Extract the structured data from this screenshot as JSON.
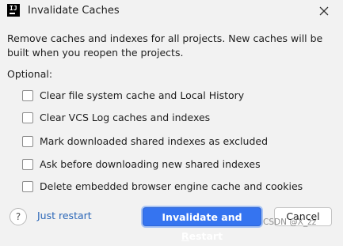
{
  "window": {
    "title": "Invalidate Caches",
    "app_icon_text": "IJ"
  },
  "description": "Remove caches and indexes for all projects. New caches will be built when you reopen the projects.",
  "optional_label": "Optional:",
  "options": [
    {
      "label": "Clear file system cache and Local History",
      "checked": false
    },
    {
      "label": "Clear VCS Log caches and indexes",
      "checked": false
    },
    {
      "label": "Mark downloaded shared indexes as excluded",
      "checked": false
    },
    {
      "label": "Ask before downloading new shared indexes",
      "checked": false
    },
    {
      "label": "Delete embedded browser engine cache and cookies",
      "checked": false
    }
  ],
  "footer": {
    "help_label": "?",
    "just_restart_label": "Just restart",
    "primary_label_pre": "Invalidate and ",
    "primary_label_mnemonic": "R",
    "primary_label_post": "estart",
    "cancel_label": "Cancel"
  },
  "watermark": "CSDN @X_zz",
  "colors": {
    "primary": "#3574f0",
    "link": "#2a66b7"
  }
}
